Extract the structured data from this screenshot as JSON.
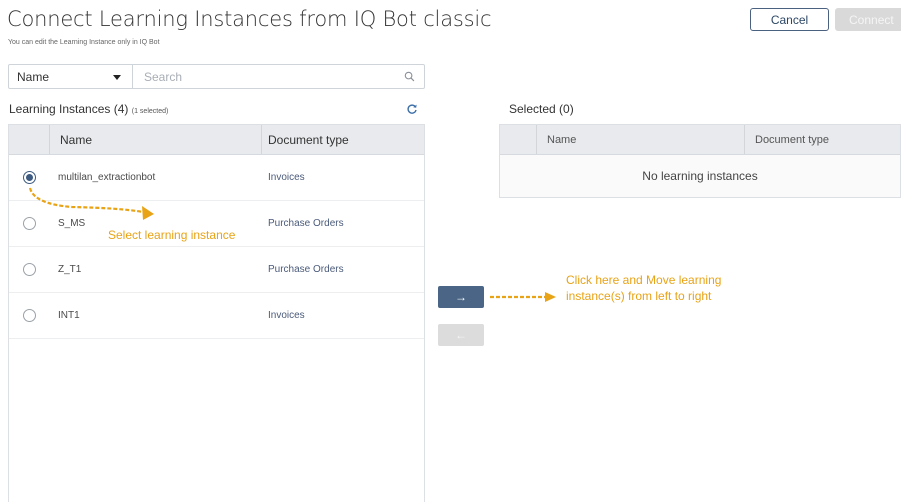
{
  "header": {
    "title": "Connect Learning Instances from IQ Bot classic",
    "subtitle": "You can edit the Learning Instance only in IQ Bot",
    "cancel_label": "Cancel",
    "connect_label": "Connect"
  },
  "filter": {
    "field_value": "Name",
    "search_placeholder": "Search"
  },
  "left_panel": {
    "heading": "Learning Instances",
    "count": "(4)",
    "selected_note": "(1 selected)",
    "columns": [
      "Name",
      "Document type"
    ],
    "rows": [
      {
        "name": "multilan_extractionbot",
        "type": "Invoices",
        "selected": true
      },
      {
        "name": "S_MS",
        "type": "Purchase Orders",
        "selected": false
      },
      {
        "name": "Z_T1",
        "type": "Purchase Orders",
        "selected": false
      },
      {
        "name": "INT1",
        "type": "Invoices",
        "selected": false
      }
    ]
  },
  "right_panel": {
    "heading": "Selected (0)",
    "columns": [
      "Name",
      "Document type"
    ],
    "empty_text": "No learning instances"
  },
  "move": {
    "right_label": "→",
    "left_label": "←"
  },
  "annotations": {
    "select_text": "Select learning instance",
    "move_text": "Click here and Move learning instance(s) from left to right",
    "color": "#e8a317"
  },
  "colors": {
    "primary": "#4a6585",
    "accent_annotation": "#e8a317"
  }
}
